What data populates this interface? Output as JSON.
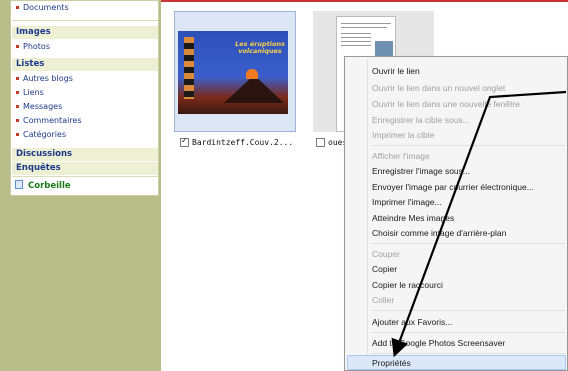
{
  "sidebar": {
    "top_item": "Documents",
    "sections": [
      {
        "heading": "Images",
        "items": [
          "Photos"
        ]
      },
      {
        "heading": "Listes",
        "items": [
          "Autres blogs",
          "Liens",
          "Messages",
          "Commentaires",
          "Catégories"
        ]
      },
      {
        "heading": "Discussions",
        "items": []
      },
      {
        "heading": "Enquêtes",
        "items": []
      }
    ],
    "trash": "Corbeille"
  },
  "cover": {
    "title": "Les éruptions volcaniques"
  },
  "files": [
    {
      "name": "Bardintzeff.Couv.2...",
      "checked": true
    },
    {
      "name": "oues",
      "checked": false
    }
  ],
  "context_menu": {
    "items": [
      {
        "label": "Ouvrir le lien",
        "enabled": true
      },
      {
        "label": "Ouvrir le lien dans un nouvel onglet",
        "enabled": false
      },
      {
        "label": "Ouvrir le lien dans une nouvelle fenêtre",
        "enabled": false
      },
      {
        "label": "Enregistrer la cible sous...",
        "enabled": false
      },
      {
        "label": "Imprimer la cible",
        "enabled": false
      },
      {
        "label": "Afficher l'image",
        "enabled": false
      },
      {
        "label": "Enregistrer l'image sous...",
        "enabled": true
      },
      {
        "label": "Envoyer l'image par courrier électronique...",
        "enabled": true
      },
      {
        "label": "Imprimer l'image...",
        "enabled": true
      },
      {
        "label": "Atteindre Mes images",
        "enabled": true
      },
      {
        "label": "Choisir comme image d'arrière-plan",
        "enabled": true
      },
      {
        "label": "Couper",
        "enabled": false
      },
      {
        "label": "Copier",
        "enabled": true
      },
      {
        "label": "Copier le raccourci",
        "enabled": true
      },
      {
        "label": "Coller",
        "enabled": false
      },
      {
        "label": "Ajouter aux Favoris...",
        "enabled": true
      },
      {
        "label": "Add to Google Photos Screensaver",
        "enabled": true
      },
      {
        "label": "Propriétés",
        "enabled": true,
        "highlighted": true
      }
    ]
  },
  "colors": {
    "sidebar_olive": "#b9bd8a",
    "link_blue": "#1e3a8a",
    "trash_green": "#1a7a1a",
    "menu_highlight": "#dbe8f8"
  }
}
